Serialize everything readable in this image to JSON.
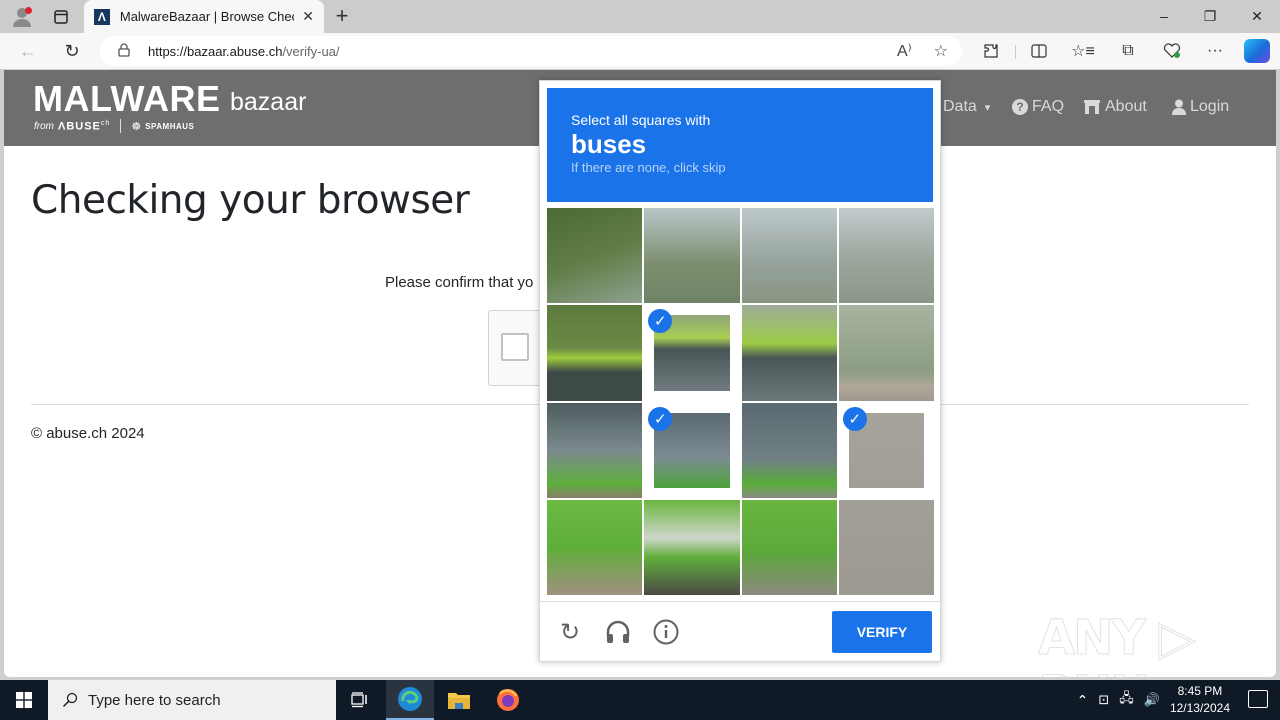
{
  "browser": {
    "tab_title": "MalwareBazaar | Browse Checking",
    "favicon_letter": "Λ",
    "url_host": "https://bazaar.abuse.ch",
    "url_path": "/verify-ua/",
    "icons": {
      "profile": "profile-icon",
      "tabs": "tab-actions-icon",
      "new_tab": "+",
      "minimize": "–",
      "restore": "❐",
      "close": "✕",
      "back": "←",
      "reload": "↻",
      "lock": "🔒",
      "read_aloud": "A⁾",
      "favorite": "☆",
      "extensions": "⚙",
      "split": "◫",
      "favorites": "☆≡",
      "collections": "⧉",
      "health": "♡",
      "more": "···"
    }
  },
  "site": {
    "logo_main": "MALWARE",
    "logo_sub": "bazaar",
    "logo_from": "from",
    "logo_abuse": "ΛBUSE",
    "logo_abuse_sup": "ch",
    "logo_spamhaus": "SPAMHAUS",
    "nav": [
      {
        "label": "Data",
        "icon": "▾"
      },
      {
        "label": "FAQ",
        "icon": "?"
      },
      {
        "label": "About",
        "icon": "▇"
      },
      {
        "label": "Login",
        "icon": "👤"
      }
    ],
    "heading": "Checking your browser",
    "confirm_text": "Please confirm that yo",
    "footer": "© abuse.ch 2024",
    "watermark": "ANY ▷ RUN"
  },
  "captcha": {
    "line1": "Select all squares with",
    "target": "buses",
    "line3": "If there are none, click skip",
    "tiles_selected": [
      false,
      false,
      false,
      false,
      false,
      true,
      false,
      false,
      false,
      true,
      false,
      true,
      false,
      false,
      false,
      false
    ],
    "check_glyph": "✓",
    "verify_label": "VERIFY",
    "reload_icon": "↻",
    "audio_icon": "🎧",
    "info_icon": "ⓘ"
  },
  "taskbar": {
    "search_placeholder": "Type here to search",
    "time": "8:45 PM",
    "date": "12/13/2024",
    "tray_chevron": "^"
  }
}
